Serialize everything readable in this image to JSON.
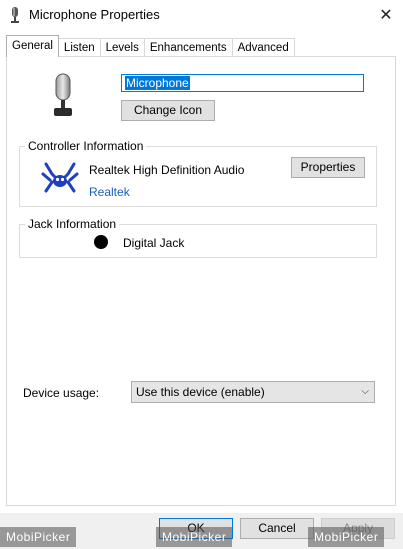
{
  "window": {
    "title": "Microphone Properties",
    "close_glyph": "✕"
  },
  "tabs": [
    {
      "label": "General",
      "active": true
    },
    {
      "label": "Listen"
    },
    {
      "label": "Levels"
    },
    {
      "label": "Enhancements"
    },
    {
      "label": "Advanced"
    }
  ],
  "general": {
    "device_name": "Microphone",
    "change_icon_label": "Change Icon"
  },
  "controller": {
    "legend": "Controller Information",
    "name": "Realtek High Definition Audio",
    "vendor_link": "Realtek",
    "properties_label": "Properties"
  },
  "jack": {
    "legend": "Jack Information",
    "type": "Digital Jack"
  },
  "usage": {
    "label": "Device usage:",
    "selected": "Use this device (enable)"
  },
  "footer": {
    "ok_label": "OK",
    "cancel_label": "Cancel",
    "apply_label": "Apply"
  },
  "watermark": {
    "text": "MobiPicker"
  },
  "icons": {
    "window": "microphone-icon",
    "device": "microphone-device-icon",
    "controller": "realtek-crab-icon",
    "dropdown": "chevron-down-icon",
    "close": "close-icon"
  },
  "colors": {
    "accent": "#0078d7",
    "link": "#1a5fb4"
  }
}
